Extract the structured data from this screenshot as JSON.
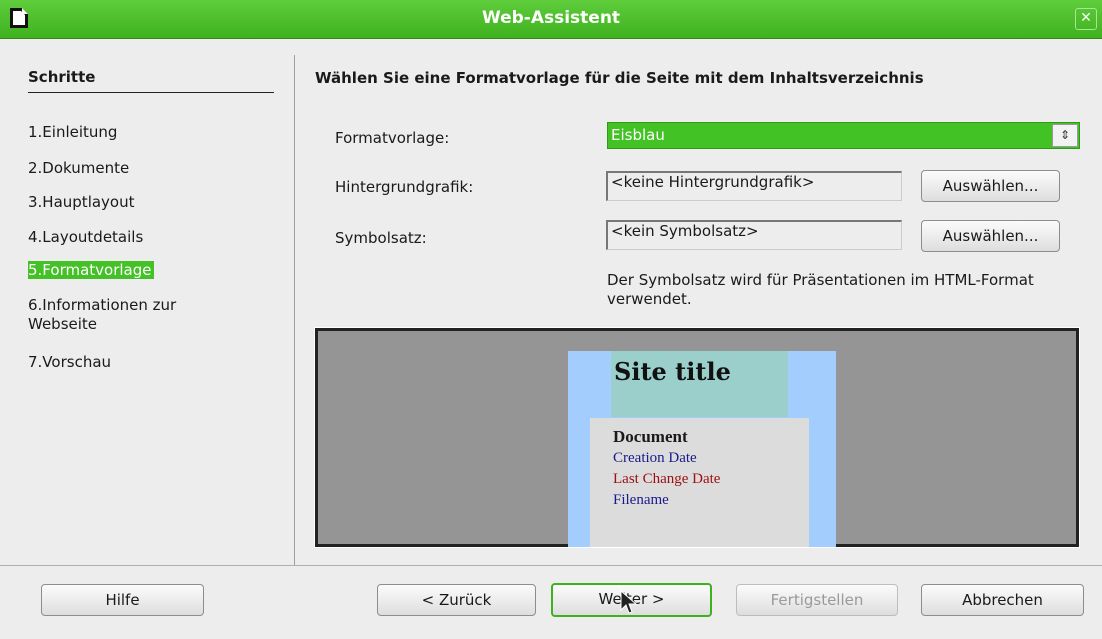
{
  "window": {
    "title": "Web-Assistent",
    "close_label": "✕"
  },
  "sidebar": {
    "title": "Schritte",
    "steps": [
      {
        "label": "1.Einleitung"
      },
      {
        "label": "2.Dokumente"
      },
      {
        "label": "3.Hauptlayout"
      },
      {
        "label": "4.Layoutdetails"
      },
      {
        "label": "5.Formatvorlage",
        "active": true
      },
      {
        "label": "6.Informationen zur Webseite"
      },
      {
        "label": "7.Vorschau"
      }
    ]
  },
  "main": {
    "heading": "Wählen Sie eine Formatvorlage für die Seite mit dem Inhaltsverzeichnis",
    "style": {
      "label": "Formatvorlage:",
      "value": "Eisblau"
    },
    "background": {
      "label": "Hintergrundgrafik:",
      "value": "<keine Hintergrundgrafik>",
      "button": "Auswählen..."
    },
    "iconset": {
      "label": "Symbolsatz:",
      "value": "<kein Symbolsatz>",
      "button": "Auswählen..."
    },
    "note": "Der Symbolsatz wird für Präsentationen im HTML-Format verwendet.",
    "preview": {
      "site_title": "Site title",
      "doc_title": "Document",
      "creation_date": "Creation Date",
      "last_change": "Last Change Date",
      "filename": "Filename"
    }
  },
  "footer": {
    "help": "Hilfe",
    "back": "< Zurück",
    "next": "Weiter >",
    "finish": "Fertigstellen",
    "cancel": "Abbrechen"
  },
  "colors": {
    "accent": "#43c226",
    "preview_bg": "#959595",
    "page_bg": "#a3cdfd",
    "header_bg": "#9bcfcc"
  }
}
